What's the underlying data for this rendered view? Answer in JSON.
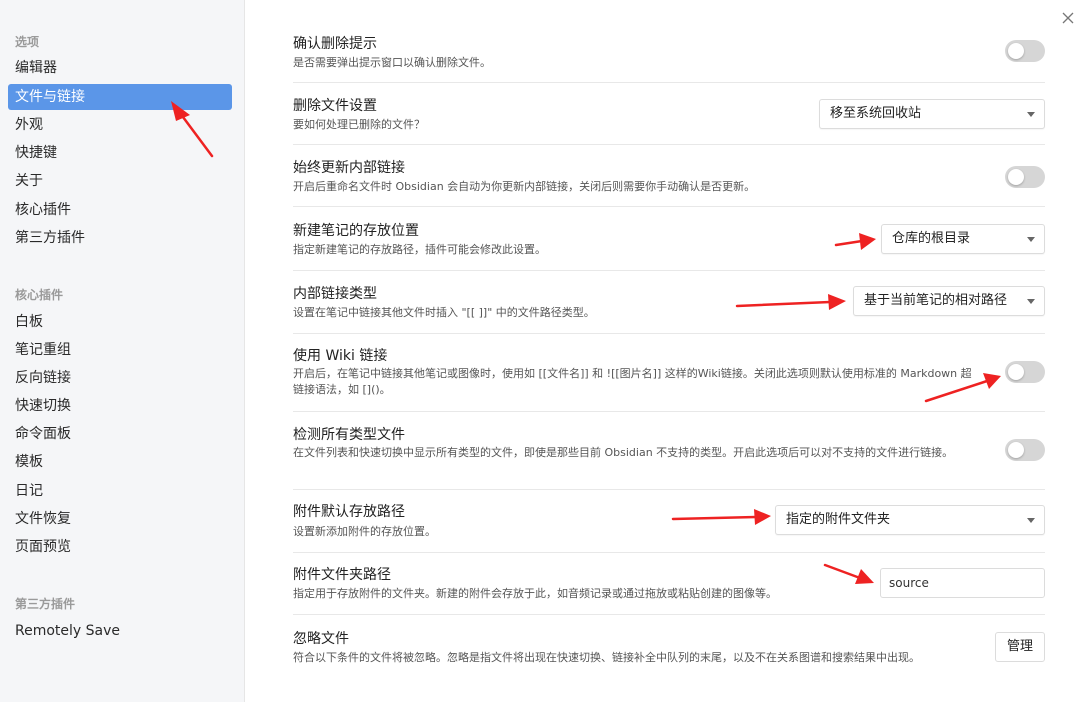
{
  "sidebar": {
    "section_options": "选项",
    "options": [
      "编辑器",
      "文件与链接",
      "外观",
      "快捷键",
      "关于",
      "核心插件",
      "第三方插件"
    ],
    "active_index": 1,
    "section_core": "核心插件",
    "core_plugins": [
      "白板",
      "笔记重组",
      "反向链接",
      "快速切换",
      "命令面板",
      "模板",
      "日记",
      "文件恢复",
      "页面预览"
    ],
    "section_third": "第三方插件",
    "third_plugins": [
      "Remotely Save"
    ]
  },
  "settings": [
    {
      "name": "确认删除提示",
      "desc": "是否需要弹出提示窗口以确认删除文件。",
      "control": "toggle",
      "on": false
    },
    {
      "name": "删除文件设置",
      "desc": "要如何处理已删除的文件？",
      "control": "dropdown",
      "value": "移至系统回收站"
    },
    {
      "name": "始终更新内部链接",
      "desc": "开启后重命名文件时 Obsidian 会自动为你更新内部链接，关闭后则需要你手动确认是否更新。",
      "control": "toggle",
      "on": false
    },
    {
      "name": "新建笔记的存放位置",
      "desc": "指定新建笔记的存放路径，插件可能会修改此设置。",
      "control": "dropdown",
      "value": "仓库的根目录"
    },
    {
      "name": "内部链接类型",
      "desc": "设置在笔记中链接其他文件时插入 \"[[ ]]\" 中的文件路径类型。",
      "control": "dropdown",
      "value": "基于当前笔记的相对路径"
    },
    {
      "name": "使用 Wiki 链接",
      "desc": "开启后，在笔记中链接其他笔记或图像时，使用如 [[文件名]] 和 ![[图片名]] 这样的Wiki链接。关闭此选项则默认使用标准的 Markdown 超链接语法，如 []()。",
      "control": "toggle",
      "on": false
    },
    {
      "name": "检测所有类型文件",
      "desc": "在文件列表和快速切换中显示所有类型的文件，即使是那些目前 Obsidian 不支持的类型。开启此选项后可以对不支持的文件进行链接。",
      "control": "toggle",
      "on": false
    },
    {
      "name": "附件默认存放路径",
      "desc": "设置新添加附件的存放位置。",
      "control": "dropdown",
      "value": "指定的附件文件夹"
    },
    {
      "name": "附件文件夹路径",
      "desc": "指定用于存放附件的文件夹。新建的附件会存放于此，如音频记录或通过拖放或粘贴创建的图像等。",
      "control": "text",
      "value": "source"
    },
    {
      "name": "忽略文件",
      "desc": "符合以下条件的文件将被忽略。忽略是指文件将出现在快速切换、链接补全中队列的末尾，以及不在关系图谱和搜索结果中出现。",
      "control": "button",
      "value": "管理"
    }
  ],
  "colors": {
    "active": "#5b96e8",
    "annotation_arrow": "#ee2222",
    "toggle_off": "#d6d6d6"
  }
}
